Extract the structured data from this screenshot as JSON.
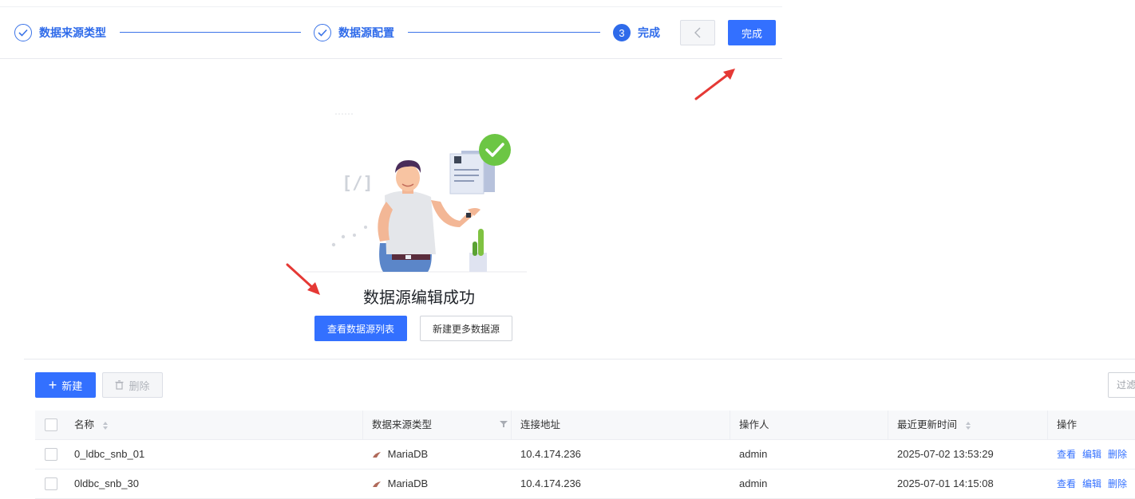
{
  "steps": [
    {
      "label": "数据来源类型",
      "status": "done"
    },
    {
      "label": "数据源配置",
      "status": "done"
    },
    {
      "label": "完成",
      "number": "3",
      "status": "active"
    }
  ],
  "header": {
    "prev_icon": "chevron-left-icon",
    "finish_label": "完成"
  },
  "result": {
    "title": "数据源编辑成功",
    "primary_button": "查看数据源列表",
    "secondary_button": "新建更多数据源"
  },
  "toolbar": {
    "new_label": "新建",
    "delete_label": "删除",
    "filter_placeholder": "过滤"
  },
  "table": {
    "columns": [
      "名称",
      "数据来源类型",
      "连接地址",
      "操作人",
      "最近更新时间",
      "操作"
    ],
    "rows": [
      {
        "name": "0_ldbc_snb_01",
        "type": "MariaDB",
        "address": "10.4.174.236",
        "operator": "admin",
        "updated": "2025-07-02 13:53:29"
      },
      {
        "name": "0ldbc_snb_30",
        "type": "MariaDB",
        "address": "10.4.174.236",
        "operator": "admin",
        "updated": "2025-07-01 14:15:08"
      }
    ],
    "actions": [
      "查看",
      "编辑",
      "删除"
    ]
  },
  "colors": {
    "primary": "#3370ff",
    "step_blue": "#2f6bea",
    "success_green": "#6cc644",
    "annotation_red": "#e53935"
  }
}
